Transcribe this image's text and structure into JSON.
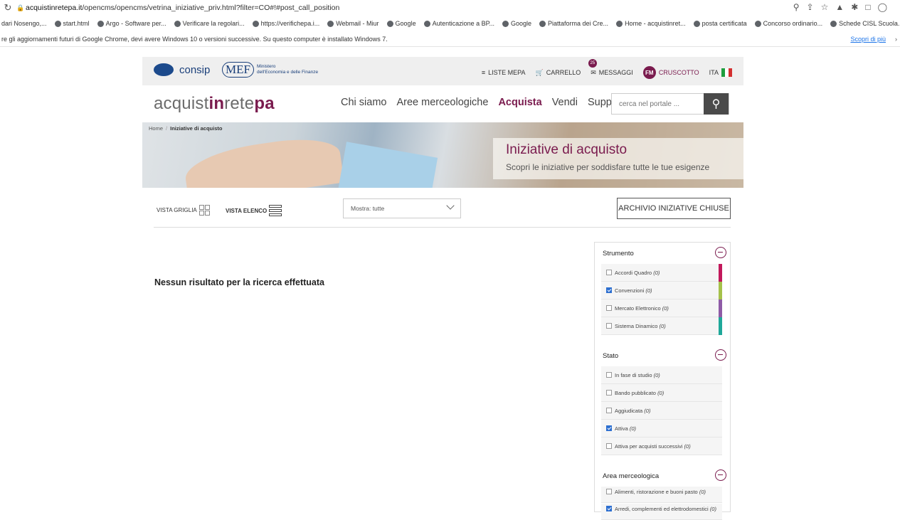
{
  "browser": {
    "url_domain": "acquistinretepa.it",
    "url_path": "/opencms/opencms/vetrina_iniziative_priv.html?filter=CO#!#post_call_position",
    "bookmarks": [
      "dari Nosengo,...",
      "start.html",
      "Argo - Software per...",
      "Verificare la regolari...",
      "https://verifichepa.i...",
      "Webmail - Miur",
      "Google",
      "Autenticazione a BP...",
      "Google",
      "Piattaforma dei Cre...",
      "Home - acquistinret...",
      "posta certificata",
      "Concorso ordinario...",
      "Schede CISL Scuola..."
    ],
    "infobar_text": "re gli aggiornamenti futuri di Google Chrome, devi avere Windows 10 o versioni successive. Su questo computer è installato Windows 7.",
    "infobar_link": "Scopri di più"
  },
  "header": {
    "consip": "consip",
    "mef": "MEF",
    "mef_text_1": "Ministero",
    "mef_text_2": "dell'Economia e delle Finanze",
    "liste_mepa": "LISTE MEPA",
    "carrello": "CARRELLO",
    "messaggi": "MESSAGGI",
    "messaggi_badge": "25",
    "avatar": "FM",
    "cruscotto": "CRUSCOTTO",
    "lang": "ITA"
  },
  "nav": {
    "brand_1": "acquist",
    "brand_2": "in",
    "brand_3": "rete",
    "brand_4": "pa",
    "items": [
      "Chi siamo",
      "Aree merceologiche",
      "Acquista",
      "Vendi",
      "Supporto"
    ],
    "search_placeholder": "cerca nel portale ..."
  },
  "hero": {
    "breadcrumb_home": "Home",
    "breadcrumb_current": "Iniziative di acquisto",
    "title": "Iniziative di acquisto",
    "subtitle": "Scopri le iniziative per soddisfare tutte le tue esigenze"
  },
  "viewbar": {
    "grid": "VISTA GRIGLIA",
    "list": "VISTA ELENCO",
    "select": "Mostra: tutte",
    "archive": "ARCHIVIO INIZIATIVE CHIUSE"
  },
  "results": {
    "empty": "Nessun risultato per la ricerca effettuata"
  },
  "filters": {
    "strumento": {
      "title": "Strumento",
      "options": [
        {
          "label": "Accordi Quadro",
          "count": "(0)",
          "checked": false,
          "color": "#c2185b"
        },
        {
          "label": "Convenzioni",
          "count": "(0)",
          "checked": true,
          "color": "#a5c14a"
        },
        {
          "label": "Mercato Elettronico",
          "count": "(0)",
          "checked": false,
          "color": "#8e5ba6"
        },
        {
          "label": "Sistema Dinamico",
          "count": "(0)",
          "checked": false,
          "color": "#1fa89a"
        }
      ]
    },
    "stato": {
      "title": "Stato",
      "options": [
        {
          "label": "In fase di studio",
          "count": "(0)",
          "checked": false
        },
        {
          "label": "Bando pubblicato",
          "count": "(0)",
          "checked": false
        },
        {
          "label": "Aggiudicata",
          "count": "(0)",
          "checked": false
        },
        {
          "label": "Attiva",
          "count": "(0)",
          "checked": true
        },
        {
          "label": "Attiva per acquisti successivi",
          "count": "(0)",
          "checked": false
        }
      ]
    },
    "area": {
      "title": "Area merceologica",
      "options": [
        {
          "label": "Alimenti, ristorazione e buoni pasto",
          "count": "(0)",
          "checked": false
        },
        {
          "label": "Arredi, complementi ed elettrodomestici",
          "count": "(0)",
          "checked": true
        }
      ]
    }
  },
  "colors": {
    "brand": "#7a1b4e",
    "checkbox": "#2d6fd0",
    "flag_green": "#1e9e3e",
    "flag_red": "#d32f2f"
  }
}
